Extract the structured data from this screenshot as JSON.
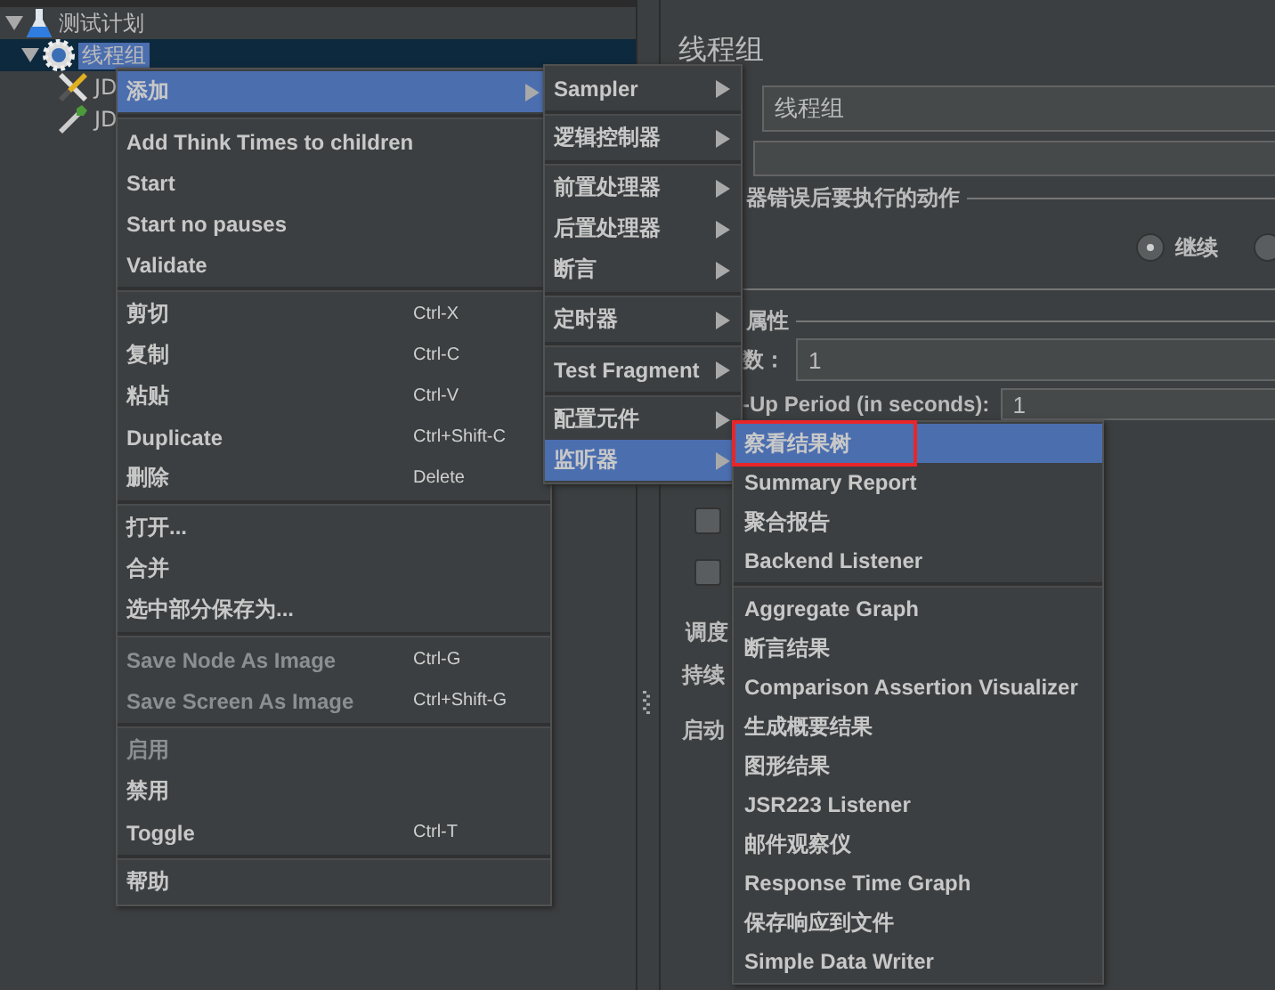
{
  "tree": [
    {
      "label": "测试计划",
      "kind": "plan",
      "expanded": true,
      "selected": false,
      "children": [
        {
          "label": "线程组",
          "kind": "group",
          "expanded": true,
          "selected": true,
          "children": [
            {
              "label": "JD",
              "kind": "sampler",
              "selected": false
            },
            {
              "label": "JD",
              "kind": "extractor",
              "selected": false
            }
          ]
        }
      ]
    }
  ],
  "context_menu": [
    [
      {
        "label": "添加",
        "submenu": true,
        "selected": true,
        "disabled": false
      }
    ],
    [
      {
        "label": "Add Think Times to children",
        "disabled": false
      },
      {
        "label": "Start",
        "disabled": false
      },
      {
        "label": "Start no pauses",
        "disabled": false
      },
      {
        "label": "Validate",
        "disabled": false
      }
    ],
    [
      {
        "label": "剪切",
        "shortcut": "Ctrl-X",
        "disabled": false
      },
      {
        "label": "复制",
        "shortcut": "Ctrl-C",
        "disabled": false
      },
      {
        "label": "粘贴",
        "shortcut": "Ctrl-V",
        "disabled": false
      },
      {
        "label": "Duplicate",
        "shortcut": "Ctrl+Shift-C",
        "disabled": false
      },
      {
        "label": "删除",
        "shortcut": "Delete",
        "disabled": false
      }
    ],
    [
      {
        "label": "打开...",
        "disabled": false
      },
      {
        "label": "合并",
        "disabled": false
      },
      {
        "label": "选中部分保存为...",
        "disabled": false
      }
    ],
    [
      {
        "label": "Save Node As Image",
        "shortcut": "Ctrl-G",
        "disabled": true
      },
      {
        "label": "Save Screen As Image",
        "shortcut": "Ctrl+Shift-G",
        "disabled": true
      }
    ],
    [
      {
        "label": "启用",
        "disabled": true
      },
      {
        "label": "禁用",
        "disabled": false
      },
      {
        "label": "Toggle",
        "shortcut": "Ctrl-T",
        "disabled": false
      }
    ],
    [
      {
        "label": "帮助",
        "disabled": false
      }
    ]
  ],
  "add_submenu": [
    [
      {
        "label": "Sampler",
        "submenu": true,
        "selected": false
      }
    ],
    [
      {
        "label": "逻辑控制器",
        "submenu": true,
        "selected": false
      }
    ],
    [
      {
        "label": "前置处理器",
        "submenu": true,
        "selected": false
      },
      {
        "label": "后置处理器",
        "submenu": true,
        "selected": false
      },
      {
        "label": "断言",
        "submenu": true,
        "selected": false
      }
    ],
    [
      {
        "label": "定时器",
        "submenu": true,
        "selected": false
      }
    ],
    [
      {
        "label": "Test Fragment",
        "submenu": true,
        "selected": false
      }
    ],
    [
      {
        "label": "配置元件",
        "submenu": true,
        "selected": false
      },
      {
        "label": "监听器",
        "submenu": true,
        "selected": true
      }
    ]
  ],
  "listener_submenu": [
    [
      {
        "label": "察看结果树",
        "selected": true,
        "annotated": true
      },
      {
        "label": "Summary Report",
        "selected": false
      },
      {
        "label": "聚合报告",
        "selected": false
      },
      {
        "label": "Backend Listener",
        "selected": false
      }
    ],
    [
      {
        "label": "Aggregate Graph",
        "selected": false
      },
      {
        "label": "断言结果",
        "selected": false
      },
      {
        "label": "Comparison Assertion Visualizer",
        "selected": false
      },
      {
        "label": "生成概要结果",
        "selected": false
      },
      {
        "label": "图形结果",
        "selected": false
      },
      {
        "label": "JSR223 Listener",
        "selected": false
      },
      {
        "label": "邮件观察仪",
        "selected": false
      },
      {
        "label": "Response Time Graph",
        "selected": false
      },
      {
        "label": "保存响应到文件",
        "selected": false
      },
      {
        "label": "Simple Data Writer",
        "selected": false
      }
    ]
  ],
  "panel": {
    "title": "线程组",
    "name_value": "线程组",
    "error_section": {
      "title": "器错误后要执行的动作",
      "options": [
        {
          "label": "继续",
          "selected": true
        },
        {
          "selected": false
        }
      ]
    },
    "thread_section": {
      "title": "属性",
      "threads_label": "数：",
      "threads_value": "1",
      "rampup_label": "-Up Period (in seconds):",
      "rampup_value": "1"
    },
    "checkboxes": [
      {
        "checked": false
      },
      {
        "checked": false
      }
    ],
    "schedule": {
      "title": "调度",
      "duration_label": "持续",
      "delay_label": "启动"
    }
  }
}
